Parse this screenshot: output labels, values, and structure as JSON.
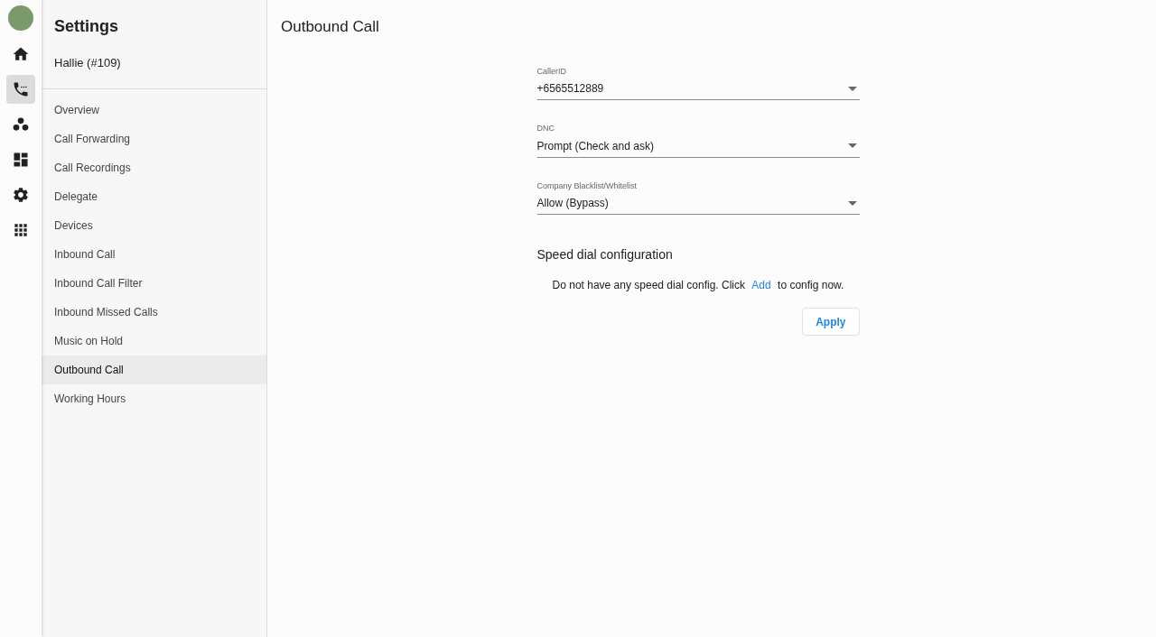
{
  "rail": {
    "items": [
      {
        "kind": "home",
        "selected": false
      },
      {
        "kind": "phone",
        "selected": true
      },
      {
        "kind": "group",
        "selected": false
      },
      {
        "kind": "dashboard",
        "selected": false
      },
      {
        "kind": "settings",
        "selected": false
      },
      {
        "kind": "apps",
        "selected": false
      }
    ]
  },
  "sidebar": {
    "title": "Settings",
    "user": "Hallie (#109)",
    "items": [
      {
        "label": "Overview",
        "selected": false
      },
      {
        "label": "Call Forwarding",
        "selected": false
      },
      {
        "label": "Call Recordings",
        "selected": false
      },
      {
        "label": "Delegate",
        "selected": false
      },
      {
        "label": "Devices",
        "selected": false
      },
      {
        "label": "Inbound Call",
        "selected": false
      },
      {
        "label": "Inbound Call Filter",
        "selected": false
      },
      {
        "label": "Inbound Missed Calls",
        "selected": false
      },
      {
        "label": "Music on Hold",
        "selected": false
      },
      {
        "label": "Outbound Call",
        "selected": true
      },
      {
        "label": "Working Hours",
        "selected": false
      }
    ]
  },
  "page": {
    "title": "Outbound Call",
    "fields": [
      {
        "label": "CallerID",
        "value": "+6565512889"
      },
      {
        "label": "DNC",
        "value": "Prompt (Check and ask)"
      },
      {
        "label": "Company Blacklist/Whitelist",
        "value": "Allow (Bypass)"
      }
    ],
    "speed_dial": {
      "heading": "Speed dial configuration",
      "text_before": "Do not have any speed dial config. Click",
      "link": "Add",
      "text_after": "to config now."
    },
    "apply_button": "Apply"
  }
}
